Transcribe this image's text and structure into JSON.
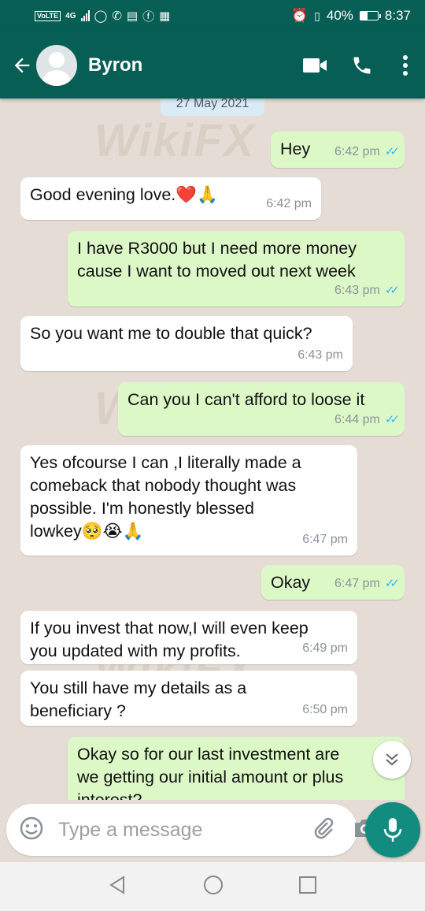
{
  "status_bar": {
    "network": "VoLTE",
    "network_type": "4G",
    "battery": "40%",
    "time": "8:37"
  },
  "header": {
    "contact_name": "Byron"
  },
  "chat": {
    "date_chip": "27 May 2021",
    "messages": [
      {
        "dir": "out",
        "text": "Hey",
        "time": "6:42 pm"
      },
      {
        "dir": "in",
        "text": "Good evening love.❤️🙏",
        "time": "6:42 pm"
      },
      {
        "dir": "out",
        "text": "I have R3000 but I need more money\ncause I want to moved out next week",
        "time": "6:43 pm"
      },
      {
        "dir": "in",
        "text": "So you want me to double that quick?",
        "time": "6:43 pm"
      },
      {
        "dir": "out",
        "text": "Can you I can't afford to loose it",
        "time": "6:44 pm"
      },
      {
        "dir": "in",
        "text": "Yes ofcourse I can ,I literally made a\ncomeback that nobody thought was\npossible.  I'm honestly blessed\nlowkey🥺😭🙏",
        "time": "6:47 pm"
      },
      {
        "dir": "out",
        "text": "Okay",
        "time": "6:47 pm"
      },
      {
        "dir": "in",
        "text": "If you invest that now,I will even keep\nyou updated with my profits.",
        "time": "6:49 pm"
      },
      {
        "dir": "in",
        "text": "You still have my details as a\nbeneficiary ?",
        "time": "6:50 pm"
      },
      {
        "dir": "out",
        "text": "Okay so for our last investment are\nwe getting our initial amount or plus\ninterest?",
        "time": ""
      }
    ],
    "watermark": "WikiFX"
  },
  "composer": {
    "placeholder": "Type a message"
  },
  "colors": {
    "header": "#075e54",
    "incoming": "#ffffff",
    "outgoing": "#dcf8c6",
    "read_ticks": "#34b7f1",
    "mic_button": "#128c7e"
  }
}
